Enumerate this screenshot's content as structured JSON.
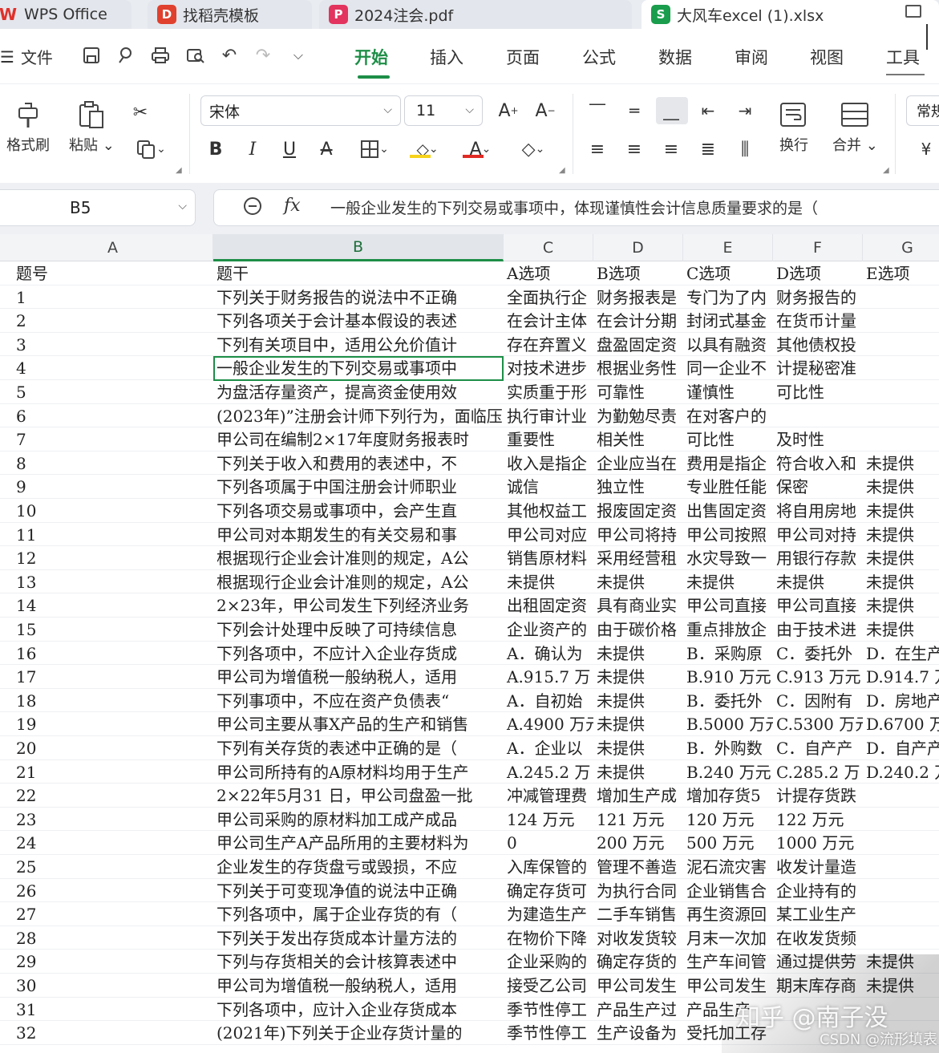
{
  "tabs": [
    {
      "label": "WPS Office",
      "icon": "wps-logo-icon"
    },
    {
      "label": "找稻壳模板",
      "icon": "docer-icon"
    },
    {
      "label": "2024注会.pdf",
      "icon": "pdf-icon"
    },
    {
      "label": "大风车excel (1).xlsx",
      "icon": "excel-icon"
    }
  ],
  "icon_glyphs": {
    "wps": "W",
    "docer": "D",
    "pdf": "P",
    "excel": "S"
  },
  "menu": {
    "file": "文件",
    "tabs": [
      "开始",
      "插入",
      "页面",
      "公式",
      "数据",
      "审阅",
      "视图",
      "工具"
    ],
    "active": "开始"
  },
  "ribbon": {
    "format_painter": "格式刷",
    "paste": "粘贴",
    "font_name": "宋体",
    "font_size": "11",
    "wrap": "换行",
    "merge": "合并",
    "number_format": "常规"
  },
  "formula_bar": {
    "cell_ref": "B5",
    "fx": "fx",
    "content": "一般企业发生的下列交易或事项中，体现谨慎性会计信息质量要求的是（"
  },
  "sheet": {
    "columns": [
      "A",
      "B",
      "C",
      "D",
      "E",
      "F",
      "G"
    ],
    "selected_column": "B",
    "rows": [
      [
        "题号",
        "题干",
        "A选项",
        "B选项",
        "C选项",
        "D选项",
        "E选项"
      ],
      [
        "1",
        "下列关于财务报告的说法中不正确",
        "全面执行企",
        "财务报表是",
        "专门为了内",
        "财务报告的",
        ""
      ],
      [
        "2",
        "下列各项关于会计基本假设的表述",
        "在会计主体",
        "在会计分期",
        "封闭式基金",
        "在货币计量",
        ""
      ],
      [
        "3",
        "下列有关项目中，适用公允价值计",
        "存在弃置义",
        "盘盈固定资",
        "以具有融资",
        "其他债权投",
        ""
      ],
      [
        "4",
        "一般企业发生的下列交易或事项中",
        "对技术进步",
        "根据业务性",
        "同一企业不",
        "计提秘密准",
        ""
      ],
      [
        "5",
        "为盘活存量资产，提高资金使用效",
        "实质重于形",
        "可靠性",
        "谨慎性",
        "可比性",
        ""
      ],
      [
        "6",
        "(2023年)”注册会计师下列行为，面临压力，",
        "执行审计业",
        "为勤勉尽责",
        "在对客户的",
        "",
        ""
      ],
      [
        "7",
        "甲公司在编制2×17年度财务报表时",
        "重要性",
        "相关性",
        "可比性",
        "及时性",
        ""
      ],
      [
        "8",
        "下列关于收入和费用的表述中，不",
        "收入是指企",
        "企业应当在",
        "费用是指企",
        "符合收入和",
        "未提供"
      ],
      [
        "9",
        "下列各项属于中国注册会计师职业",
        "诚信",
        "独立性",
        "专业胜任能",
        "保密",
        "未提供"
      ],
      [
        "10",
        "下列各项交易或事项中，会产生直",
        "其他权益工",
        "报废固定资",
        "出售固定资",
        "将自用房地",
        "未提供"
      ],
      [
        "11",
        "甲公司对本期发生的有关交易和事",
        "甲公司对应",
        "甲公司将持",
        "甲公司按照",
        "甲公司对持",
        "未提供"
      ],
      [
        "12",
        "根据现行企业会计准则的规定，A公",
        "销售原材料",
        "采用经营租",
        "水灾导致一",
        "用银行存款",
        "未提供"
      ],
      [
        "13",
        "根据现行企业会计准则的规定，A公",
        "未提供",
        "未提供",
        "未提供",
        "未提供",
        "未提供"
      ],
      [
        "14",
        "2×23年，甲公司发生下列经济业务",
        "出租固定资",
        "具有商业实",
        "甲公司直接",
        "甲公司直接",
        "未提供"
      ],
      [
        "15",
        "下列会计处理中反映了可持续信息",
        "企业资产的",
        "由于碳价格",
        "重点排放企",
        "由于技术进",
        "未提供"
      ],
      [
        "16",
        "下列各项中，不应计入企业存货成",
        "A．确认为",
        "未提供",
        "B．采购原",
        "C．委托外",
        "D．在生产"
      ],
      [
        "17",
        "甲公司为增值税一般纳税人，适用",
        "A.915.7 万",
        "未提供",
        "B.910 万元",
        "C.913 万元",
        "D.914.7 万"
      ],
      [
        "18",
        "下列事项中，不应在资产负债表“",
        "A．自初始",
        "未提供",
        "B．委托外",
        "C．因附有",
        "D．房地产"
      ],
      [
        "19",
        "甲公司主要从事X产品的生产和销售",
        "A.4900 万元",
        "未提供",
        "B.5000 万元",
        "C.5300 万元",
        "D.6700 万"
      ],
      [
        "20",
        "下列有关存货的表述中正确的是（",
        "A．企业以",
        "未提供",
        "B．外购数",
        "C．自产产",
        "D．自产产"
      ],
      [
        "21",
        "甲公司所持有的A原材料均用于生产",
        "A.245.2 万",
        "未提供",
        "B.240 万元",
        "C.285.2 万",
        "D.240.2 万"
      ],
      [
        "22",
        "2×22年5月31 日，甲公司盘盈一批",
        "冲减管理费",
        "增加生产成",
        "增加存货5",
        "计提存货跌",
        ""
      ],
      [
        "23",
        "甲公司采购的原材料加工成产成品",
        "124 万元",
        "121 万元",
        "120 万元",
        "122 万元",
        ""
      ],
      [
        "24",
        "甲公司生产A产品所用的主要材料为",
        "0",
        "200 万元",
        "500 万元",
        "1000 万元",
        ""
      ],
      [
        "25",
        "企业发生的存货盘亏或毁损，不应",
        "入库保管的",
        "管理不善造",
        "泥石流灾害",
        "收发计量造",
        ""
      ],
      [
        "26",
        "下列关于可变现净值的说法中正确",
        "确定存货可",
        "为执行合同",
        "企业销售合",
        "企业持有的",
        ""
      ],
      [
        "27",
        "下列各项中，属于企业存货的有（",
        "为建造生产",
        "二手车销售",
        "再生资源回",
        "某工业生产",
        ""
      ],
      [
        "28",
        "下列关于发出存货成本计量方法的",
        "在物价下降",
        "对收发货较",
        "月末一次加",
        "在收发货频",
        ""
      ],
      [
        "29",
        "下列与存货相关的会计核算表述中",
        "企业采购的",
        "确定存货的",
        "生产车间管",
        "通过提供劳",
        "未提供"
      ],
      [
        "30",
        "甲公司为增值税一般纳税人，适用",
        "接受乙公司",
        "甲公司发生",
        "甲公司发生",
        "期末库存商",
        "未提供"
      ],
      [
        "31",
        "下列各项中，应计入企业存货成本",
        "季节性停工",
        "产品生产过",
        "产品生产",
        "",
        ""
      ],
      [
        "32",
        "(2021年)下列关于企业存货计量的",
        "季节性停工",
        "生产设备为",
        "受托加工存",
        "",
        ""
      ]
    ]
  },
  "watermark": {
    "main": "知乎 @南子没",
    "sub": "CSDN @流形填表"
  }
}
